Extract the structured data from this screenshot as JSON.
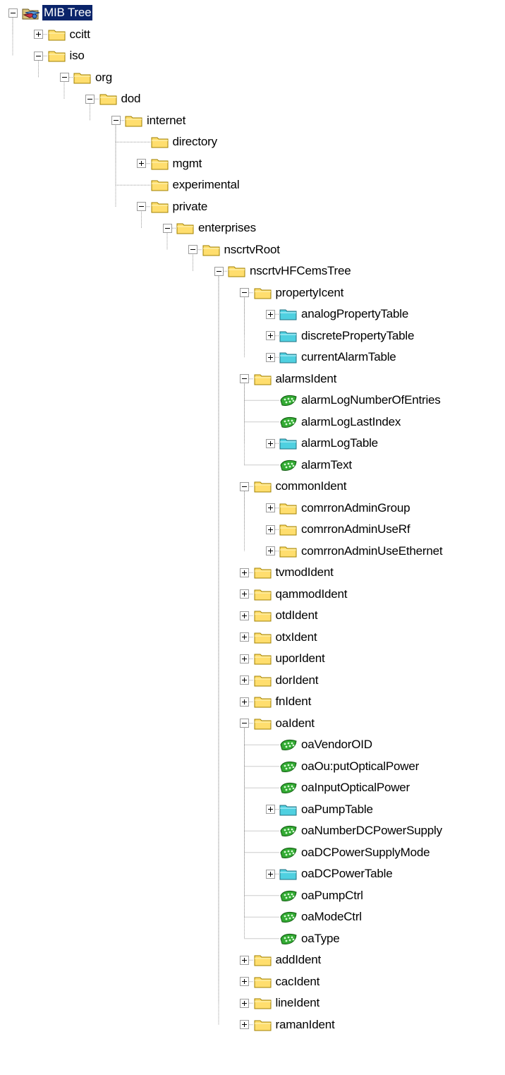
{
  "tree": {
    "root": {
      "label": "MIB Tree",
      "icon": "mib-root-icon",
      "state": "expanded",
      "selected": true
    },
    "nodes": [
      {
        "label": "ccitt",
        "level": 1,
        "icon": "folder-icon",
        "toggle": "collapsed"
      },
      {
        "label": "iso",
        "level": 1,
        "icon": "folder-icon",
        "toggle": "expanded"
      },
      {
        "label": "org",
        "level": 2,
        "icon": "folder-icon",
        "toggle": "expanded"
      },
      {
        "label": "dod",
        "level": 3,
        "icon": "folder-icon",
        "toggle": "expanded"
      },
      {
        "label": "internet",
        "level": 4,
        "icon": "folder-icon",
        "toggle": "expanded"
      },
      {
        "label": "directory",
        "level": 5,
        "icon": "folder-icon",
        "toggle": "none"
      },
      {
        "label": "mgmt",
        "level": 5,
        "icon": "folder-icon",
        "toggle": "collapsed"
      },
      {
        "label": "experimental",
        "level": 5,
        "icon": "folder-icon",
        "toggle": "none"
      },
      {
        "label": "private",
        "level": 5,
        "icon": "folder-icon",
        "toggle": "expanded"
      },
      {
        "label": "enterprises",
        "level": 6,
        "icon": "folder-icon",
        "toggle": "expanded"
      },
      {
        "label": "nscrtvRoot",
        "level": 7,
        "icon": "folder-icon",
        "toggle": "expanded"
      },
      {
        "label": "nscrtvHFCemsTree",
        "level": 8,
        "icon": "folder-icon",
        "toggle": "expanded"
      },
      {
        "label": "propertyIcent",
        "level": 9,
        "icon": "folder-icon",
        "toggle": "expanded"
      },
      {
        "label": "analogPropertyTable",
        "level": 10,
        "icon": "table-icon",
        "toggle": "collapsed"
      },
      {
        "label": "discretePropertyTable",
        "level": 10,
        "icon": "table-icon",
        "toggle": "collapsed"
      },
      {
        "label": "currentAlarmTable",
        "level": 10,
        "icon": "table-icon",
        "toggle": "collapsed"
      },
      {
        "label": "alarmsIdent",
        "level": 9,
        "icon": "folder-icon",
        "toggle": "expanded"
      },
      {
        "label": "alarmLogNumberOfEntries",
        "level": 10,
        "icon": "leaf-object-icon",
        "toggle": "none"
      },
      {
        "label": "alarmLogLastIndex",
        "level": 10,
        "icon": "leaf-object-icon",
        "toggle": "none"
      },
      {
        "label": "alarmLogTable",
        "level": 10,
        "icon": "table-icon",
        "toggle": "collapsed"
      },
      {
        "label": "alarmText",
        "level": 10,
        "icon": "leaf-object-icon",
        "toggle": "none"
      },
      {
        "label": "commonIdent",
        "level": 9,
        "icon": "folder-icon",
        "toggle": "expanded"
      },
      {
        "label": "comrronAdminGroup",
        "level": 10,
        "icon": "folder-icon",
        "toggle": "collapsed"
      },
      {
        "label": "comrronAdminUseRf",
        "level": 10,
        "icon": "folder-icon",
        "toggle": "collapsed"
      },
      {
        "label": "comrronAdminUseEthernet",
        "level": 10,
        "icon": "folder-icon",
        "toggle": "collapsed"
      },
      {
        "label": "tvmodIdent",
        "level": 9,
        "icon": "folder-icon",
        "toggle": "collapsed"
      },
      {
        "label": "qammodIdent",
        "level": 9,
        "icon": "folder-icon",
        "toggle": "collapsed"
      },
      {
        "label": "otdIdent",
        "level": 9,
        "icon": "folder-icon",
        "toggle": "collapsed"
      },
      {
        "label": "otxIdent",
        "level": 9,
        "icon": "folder-icon",
        "toggle": "collapsed"
      },
      {
        "label": "uporIdent",
        "level": 9,
        "icon": "folder-icon",
        "toggle": "collapsed"
      },
      {
        "label": "dorIdent",
        "level": 9,
        "icon": "folder-icon",
        "toggle": "collapsed"
      },
      {
        "label": "fnIdent",
        "level": 9,
        "icon": "folder-icon",
        "toggle": "collapsed"
      },
      {
        "label": "oaIdent",
        "level": 9,
        "icon": "folder-icon",
        "toggle": "expanded"
      },
      {
        "label": "oaVendorOID",
        "level": 10,
        "icon": "leaf-object-icon",
        "toggle": "none"
      },
      {
        "label": "oaOu:putOpticalPower",
        "level": 10,
        "icon": "leaf-object-icon",
        "toggle": "none"
      },
      {
        "label": "oaInputOpticalPower",
        "level": 10,
        "icon": "leaf-object-icon",
        "toggle": "none"
      },
      {
        "label": "oaPumpTable",
        "level": 10,
        "icon": "table-icon",
        "toggle": "collapsed"
      },
      {
        "label": "oaNumberDCPowerSupply",
        "level": 10,
        "icon": "leaf-object-icon",
        "toggle": "none"
      },
      {
        "label": "oaDCPowerSupplyMode",
        "level": 10,
        "icon": "leaf-object-icon",
        "toggle": "none"
      },
      {
        "label": "oaDCPowerTable",
        "level": 10,
        "icon": "table-icon",
        "toggle": "collapsed"
      },
      {
        "label": "oaPumpCtrl",
        "level": 10,
        "icon": "leaf-object-icon",
        "toggle": "none"
      },
      {
        "label": "oaModeCtrl",
        "level": 10,
        "icon": "leaf-object-icon",
        "toggle": "none"
      },
      {
        "label": "oaType",
        "level": 10,
        "icon": "leaf-object-icon",
        "toggle": "none"
      },
      {
        "label": "addIdent",
        "level": 9,
        "icon": "folder-icon",
        "toggle": "collapsed"
      },
      {
        "label": "cacIdent",
        "level": 9,
        "icon": "folder-icon",
        "toggle": "collapsed"
      },
      {
        "label": "lineIdent",
        "level": 9,
        "icon": "folder-icon",
        "toggle": "collapsed"
      },
      {
        "label": "ramanIdent",
        "level": 9,
        "icon": "folder-icon",
        "toggle": "collapsed"
      }
    ]
  },
  "colors": {
    "folder": "#ffde6e",
    "folder_dark": "#a08000",
    "table": "#4fd0e0",
    "leaf": "#33aa33",
    "selection": "#0a246a",
    "connector": "#9a9a9a"
  }
}
